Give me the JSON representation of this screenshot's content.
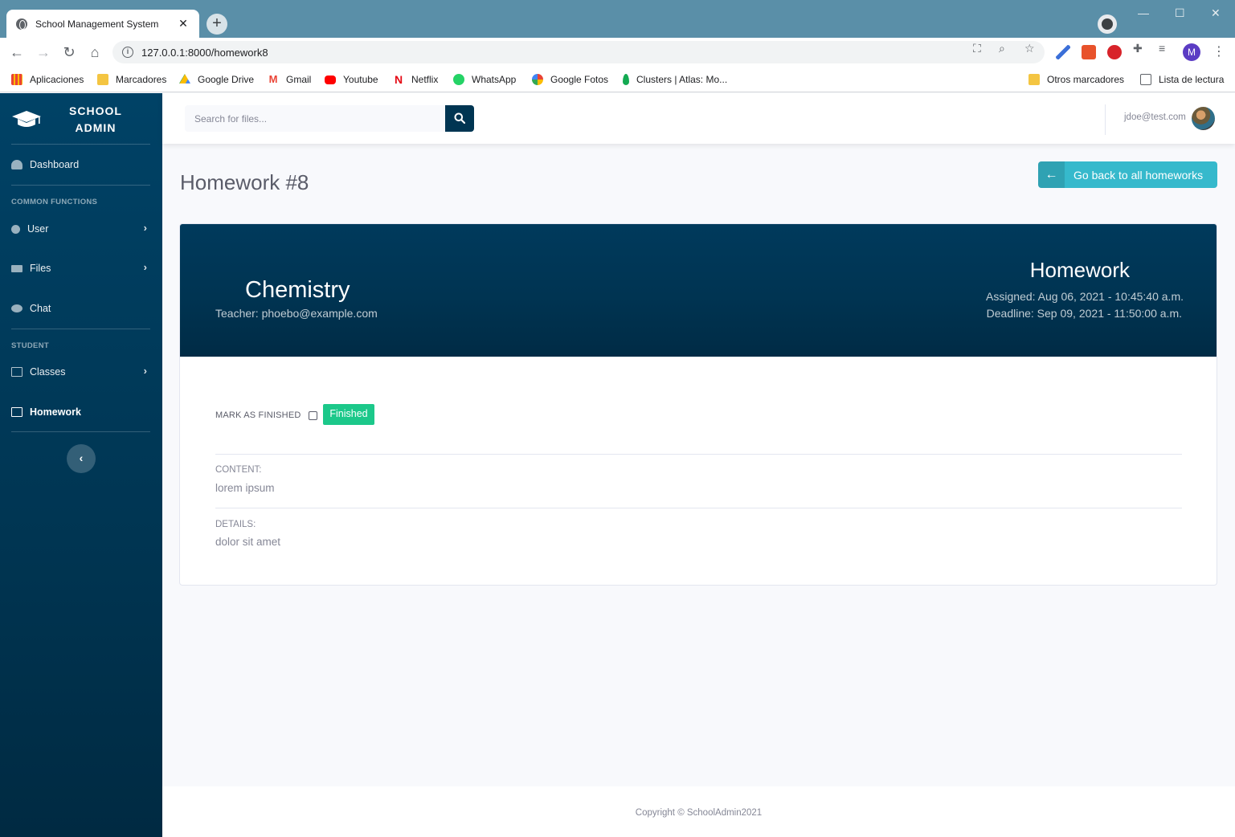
{
  "browser": {
    "tab_title": "School Management System",
    "url": "127.0.0.1:8000/homework8",
    "bookmarks": [
      {
        "label": "Aplicaciones",
        "icon": "apps-grid-icon"
      },
      {
        "label": "Marcadores",
        "icon": "folder-icon"
      },
      {
        "label": "Google Drive",
        "icon": "google-drive-icon"
      },
      {
        "label": "Gmail",
        "icon": "gmail-icon"
      },
      {
        "label": "Youtube",
        "icon": "youtube-icon"
      },
      {
        "label": "Netflix",
        "icon": "netflix-icon"
      },
      {
        "label": "WhatsApp",
        "icon": "whatsapp-icon"
      },
      {
        "label": "Google Fotos",
        "icon": "google-photos-icon"
      },
      {
        "label": "Clusters | Atlas: Mo...",
        "icon": "mongodb-leaf-icon"
      }
    ],
    "other_bookmarks": "Otros marcadores",
    "reading_list": "Lista de lectura",
    "profile_initial": "M"
  },
  "sidebar": {
    "brand_line1": "SCHOOL",
    "brand_line2": "ADMIN",
    "dashboard": "Dashboard",
    "common_heading": "COMMON FUNCTIONS",
    "user": "User",
    "files": "Files",
    "chat": "Chat",
    "student_heading": "STUDENT",
    "classes": "Classes",
    "homework": "Homework"
  },
  "topbar": {
    "search_placeholder": "Search for files...",
    "user_email": "jdoe@test.com"
  },
  "main": {
    "page_title": "Homework #8",
    "back_button": "Go back to all homeworks",
    "subject": "Chemistry",
    "teacher": "Teacher: phoebo@example.com",
    "homework_label": "Homework",
    "assigned": "Assigned: Aug 06, 2021 - 10:45:40 a.m.",
    "deadline": "Deadline: Sep 09, 2021 - 11:50:00 a.m.",
    "mark_label": "MARK AS FINISHED",
    "status_badge": "Finished",
    "content_label": "CONTENT:",
    "content_value": "lorem ipsum",
    "details_label": "DETAILS:",
    "details_value": "dolor sit amet"
  },
  "footer": {
    "copyright": "Copyright © SchoolAdmin2021"
  },
  "colors": {
    "sidebar": "#003552",
    "accent_info": "#36b9cc",
    "success": "#1cc88a",
    "text_muted": "#858796"
  }
}
